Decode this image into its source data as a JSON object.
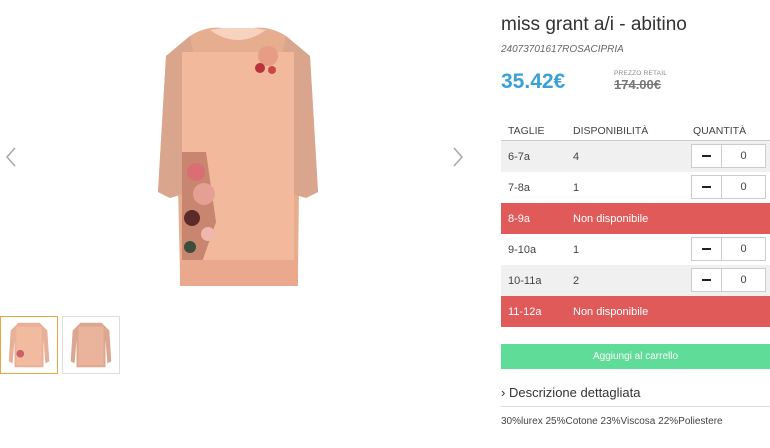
{
  "product": {
    "title": "miss grant a/i - abitino",
    "sku": "24073701617ROSACIPRIA",
    "price": "35.42€",
    "retail_label": "PREZZO RETAIL",
    "retail_price": "174.00€"
  },
  "table": {
    "headers": {
      "size": "TAGLIE",
      "availability": "DISPONIBILITÀ",
      "quantity": "QUANTITÀ"
    },
    "rows": [
      {
        "size": "6-7a",
        "availability": "4",
        "qty": "0",
        "available": true
      },
      {
        "size": "7-8a",
        "availability": "1",
        "qty": "0",
        "available": true
      },
      {
        "size": "8-9a",
        "availability": "Non disponibile",
        "available": false
      },
      {
        "size": "9-10a",
        "availability": "1",
        "qty": "0",
        "available": true
      },
      {
        "size": "10-11a",
        "availability": "2",
        "qty": "0",
        "available": true
      },
      {
        "size": "11-12a",
        "availability": "Non disponibile",
        "available": false
      }
    ]
  },
  "cart_button": "Aggiungi al carrello",
  "description": {
    "title": "Descrizione dettagliata",
    "arrow": "›",
    "text": "30%lurex 25%Cotone 23%Viscosa 22%Poliestere"
  },
  "colors": {
    "price": "#3aa1d6",
    "unavailable": "#e05a5a",
    "cart": "#5fdd98",
    "thumb_active": "#e8a640"
  },
  "icons": [
    "chevron-left-icon",
    "chevron-right-icon",
    "minus-icon"
  ]
}
